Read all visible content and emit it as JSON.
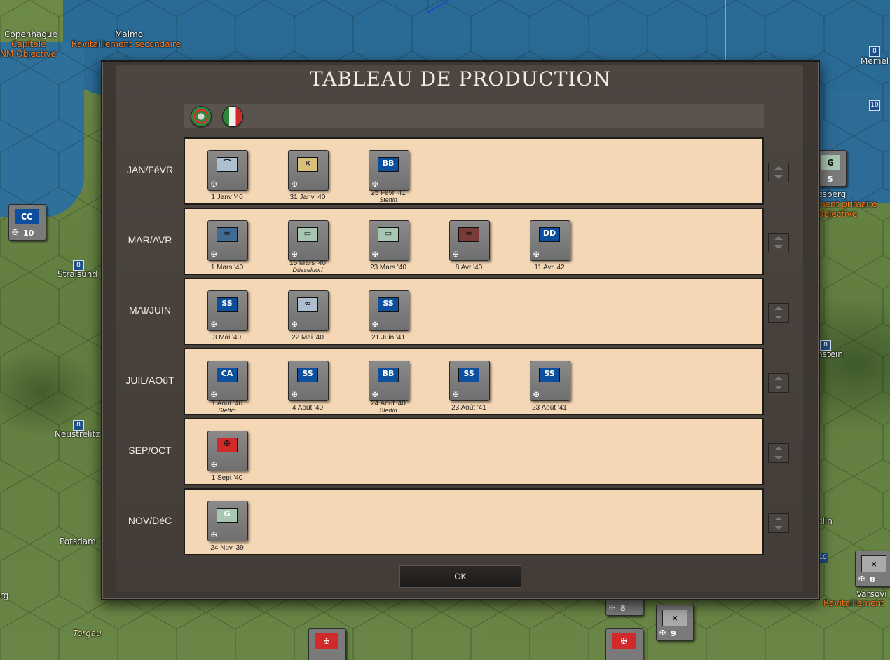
{
  "dialog": {
    "title": "TABLEAU DE PRODUCTION",
    "ok_label": "OK",
    "nations": [
      "axis-major-icon",
      "italy-icon"
    ]
  },
  "rows": [
    {
      "label": "JAN/FéVR",
      "units": [
        {
          "sym": "",
          "type": "air-fighter",
          "color": "#aebfd0",
          "date": "1 Janv '40",
          "loc": ""
        },
        {
          "sym": "",
          "type": "armor-hq",
          "color": "#d8c07a",
          "date": "31 Janv '40",
          "loc": ""
        },
        {
          "sym": "BB",
          "type": "naval",
          "color": "#0d4f9c",
          "date": "25 Févr '41",
          "loc": "Stettin"
        }
      ]
    },
    {
      "label": "MAR/AVR",
      "units": [
        {
          "sym": "",
          "type": "air-bomber",
          "color": "#3f6a92",
          "date": "1 Mars '40",
          "loc": ""
        },
        {
          "sym": "",
          "type": "armor",
          "color": "#a8c7b0",
          "date": "15 Mars '40",
          "loc": "Düsseldorf"
        },
        {
          "sym": "",
          "type": "armor",
          "color": "#a8c7b0",
          "date": "23 Mars '40",
          "loc": ""
        },
        {
          "sym": "",
          "type": "air-bomber",
          "color": "#7a3a3a",
          "date": "8 Avr '40",
          "loc": ""
        },
        {
          "sym": "DD",
          "type": "naval",
          "color": "#0d4f9c",
          "date": "11 Avr '42",
          "loc": ""
        }
      ]
    },
    {
      "label": "MAI/JUIN",
      "units": [
        {
          "sym": "SS",
          "type": "naval",
          "color": "#0d4f9c",
          "date": "3 Mai '40",
          "loc": ""
        },
        {
          "sym": "",
          "type": "air-bomber",
          "color": "#aebfd0",
          "date": "22 Mai '40",
          "loc": ""
        },
        {
          "sym": "SS",
          "type": "naval",
          "color": "#0d4f9c",
          "date": "21 Juin '41",
          "loc": ""
        }
      ]
    },
    {
      "label": "JUIL/AOûT",
      "units": [
        {
          "sym": "CA",
          "type": "naval",
          "color": "#0d4f9c",
          "date": "1 Août '40",
          "loc": "Stettin"
        },
        {
          "sym": "SS",
          "type": "naval",
          "color": "#0d4f9c",
          "date": "4 Août '40",
          "loc": ""
        },
        {
          "sym": "BB",
          "type": "naval",
          "color": "#0d4f9c",
          "date": "24 Août '40",
          "loc": "Stettin"
        },
        {
          "sym": "SS",
          "type": "naval",
          "color": "#0d4f9c",
          "date": "23 Août '41",
          "loc": ""
        },
        {
          "sym": "SS",
          "type": "naval",
          "color": "#0d4f9c",
          "date": "23 Août '41",
          "loc": ""
        }
      ]
    },
    {
      "label": "SEP/OCT",
      "units": [
        {
          "sym": "",
          "type": "flag-germany",
          "color": "#d02a2a",
          "date": "1 Sept '40",
          "loc": ""
        }
      ]
    },
    {
      "label": "NOV/DéC",
      "units": [
        {
          "sym": "G",
          "type": "garrison",
          "color": "#a8c7b0",
          "date": "24 Nov '39",
          "loc": ""
        }
      ]
    }
  ],
  "map": {
    "cities": [
      {
        "name": "Copenhague",
        "sub": "Capitale",
        "sub2": "NM Objective"
      },
      {
        "name": "Malmo",
        "sub": "Ravitaillement secondaire"
      },
      {
        "name": "Memel"
      },
      {
        "name": "Stralsund"
      },
      {
        "name": "Neustrelitz"
      },
      {
        "name": "Potsdam"
      },
      {
        "name": "Torgau"
      },
      {
        "name": "Varsovi",
        "sub": "Ravitaillement"
      },
      {
        "name": "gsberg",
        "sub": "ment primaire",
        "sub2": "Objective"
      },
      {
        "name": "nstein"
      },
      {
        "name": "rg"
      },
      {
        "name": "dlin"
      }
    ],
    "units": [
      {
        "label": "CC",
        "num": "10"
      },
      {
        "label": "G",
        "num": "5"
      },
      {
        "label": "",
        "num": "8"
      },
      {
        "label": "",
        "num": "9"
      },
      {
        "label": "",
        "num": "8"
      }
    ],
    "vp_values": [
      "8",
      "10",
      "8",
      "8",
      "8",
      "10"
    ]
  }
}
